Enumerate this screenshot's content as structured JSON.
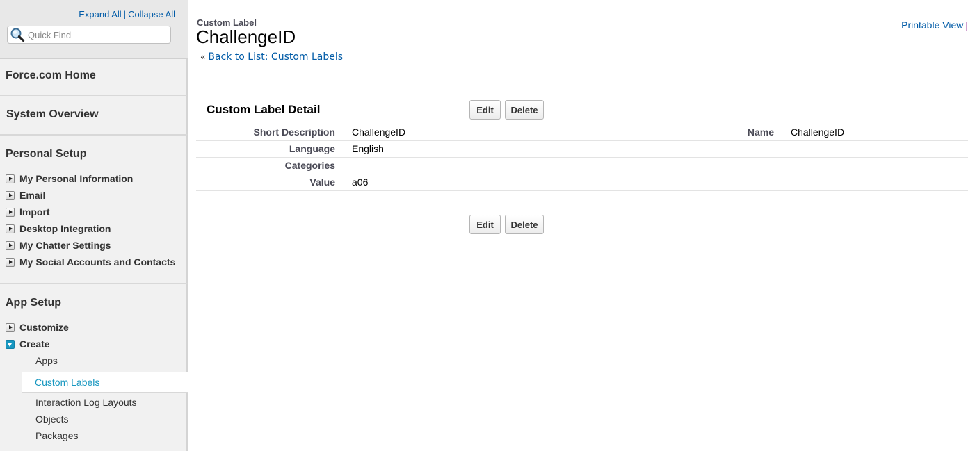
{
  "sidebar": {
    "expand_all": "Expand All",
    "separator": "|",
    "collapse_all": "Collapse All",
    "quick_find_placeholder": "Quick Find",
    "quick_find_value": "",
    "sections": {
      "home": "Force.com Home",
      "overview": "System Overview",
      "personal": {
        "title": "Personal Setup",
        "items": [
          {
            "label": "My Personal Information",
            "expanded": false
          },
          {
            "label": "Email",
            "expanded": false
          },
          {
            "label": "Import",
            "expanded": false
          },
          {
            "label": "Desktop Integration",
            "expanded": false
          },
          {
            "label": "My Chatter Settings",
            "expanded": false
          },
          {
            "label": "My Social Accounts and Contacts",
            "expanded": false
          }
        ]
      },
      "app": {
        "title": "App Setup",
        "items": [
          {
            "label": "Customize",
            "expanded": false
          },
          {
            "label": "Create",
            "expanded": true
          }
        ],
        "create_children": [
          {
            "label": "Apps",
            "selected": false
          },
          {
            "label": "Custom Labels",
            "selected": true
          },
          {
            "label": "Interaction Log Layouts",
            "selected": false
          },
          {
            "label": "Objects",
            "selected": false
          },
          {
            "label": "Packages",
            "selected": false
          }
        ]
      }
    }
  },
  "header": {
    "page_type": "Custom Label",
    "title": "ChallengeID",
    "back_prefix": "«",
    "back_link": "Back to List: Custom Labels",
    "printable_view": "Printable View",
    "printable_sep": "|"
  },
  "detail": {
    "section_title": "Custom Label Detail",
    "edit_label": "Edit",
    "delete_label": "Delete",
    "fields": [
      {
        "label": "Short Description",
        "value": "ChallengeID",
        "label2": "Name",
        "value2": "ChallengeID"
      },
      {
        "label": "Language",
        "value": "English",
        "label2": "",
        "value2": ""
      },
      {
        "label": "Categories",
        "value": "",
        "label2": "",
        "value2": ""
      },
      {
        "label": "Value",
        "value": "a06",
        "label2": "",
        "value2": ""
      }
    ]
  },
  "colors": {
    "link": "#015ba7",
    "selected_item": "#1797c0",
    "sidebar_bg": "#f1f1f1"
  }
}
